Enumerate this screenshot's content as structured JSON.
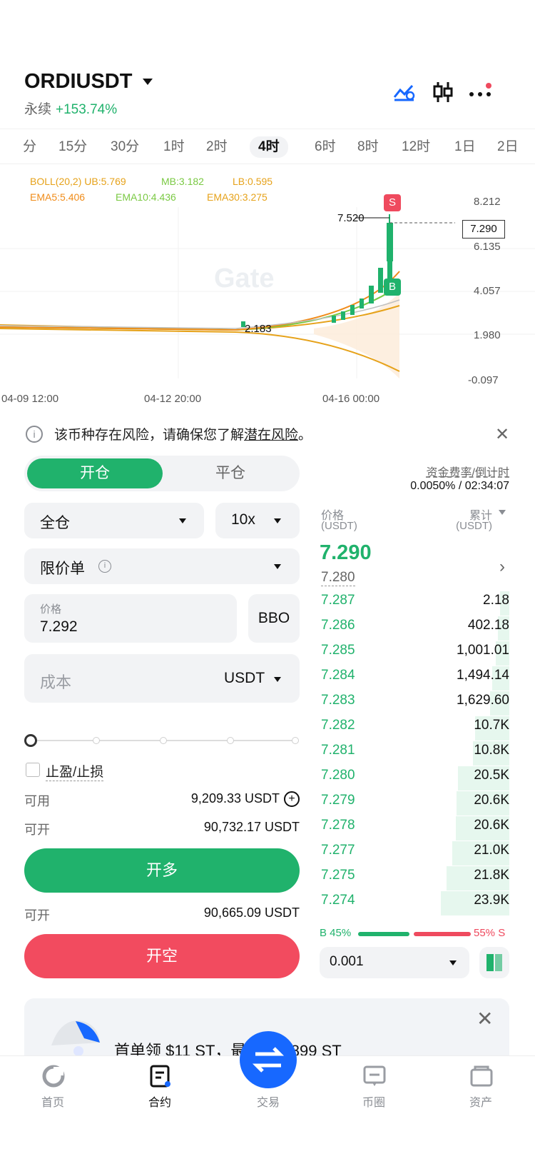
{
  "header": {
    "symbol": "ORDIUSDT",
    "contract_type": "永续",
    "change": "+153.74%",
    "icons": [
      "indicator-icon",
      "candlestick-icon",
      "more-icon"
    ]
  },
  "timeframes": [
    "分",
    "15分",
    "30分",
    "1时",
    "2时",
    "4时",
    "6时",
    "8时",
    "12时",
    "1日",
    "2日"
  ],
  "active_timeframe": "4时",
  "indicators": {
    "boll": "BOLL(20,2)",
    "ub": "UB:5.769",
    "mb": "MB:3.182",
    "lb": "LB:0.595",
    "ema5": "EMA5:5.406",
    "ema10": "EMA10:4.436",
    "ema30": "EMA30:3.275"
  },
  "chart_data": {
    "type": "candlestick",
    "y_ticks": [
      "8.212",
      "6.135",
      "4.057",
      "1.980",
      "-0.097"
    ],
    "x_ticks": [
      "04-09 12:00",
      "04-12 20:00",
      "04-16 00:00"
    ],
    "high_label": "7.520",
    "low_label": "2.183",
    "last_price_label": "7.290",
    "watermark": "Gate",
    "markers": [
      {
        "label": "S",
        "color": "#ef4a5e"
      },
      {
        "label": "B",
        "color": "#20b26c"
      }
    ]
  },
  "risk_notice": {
    "text_before": "该币种存在风险，请确保您了解",
    "link": "潜在风险",
    "text_after": "。"
  },
  "order_form": {
    "tab_open": "开仓",
    "tab_close": "平仓",
    "margin_mode": "全仓",
    "leverage": "10x",
    "order_type": "限价单",
    "price_label": "价格",
    "price_value": "7.292",
    "bbo": "BBO",
    "cost_placeholder": "成本",
    "cost_unit": "USDT",
    "tp_sl": "止盈/止损",
    "available_label": "可用",
    "available_value": "9,209.33 USDT",
    "can_open_label": "可开",
    "can_open_long": "90,732.17 USDT",
    "long_button": "开多",
    "can_open_short": "90,665.09 USDT",
    "short_button": "开空"
  },
  "funding": {
    "label": "资金费率/倒计时",
    "value": "0.0050% / 02:34:07"
  },
  "orderbook": {
    "price_header": "价格",
    "price_unit": "(USDT)",
    "total_header": "累计",
    "total_unit": "(USDT)",
    "last_price": "7.290",
    "mark_price": "7.280",
    "bids": [
      {
        "price": "7.287",
        "qty": "2.18",
        "depth": 0.08
      },
      {
        "price": "7.286",
        "qty": "402.18",
        "depth": 0.1
      },
      {
        "price": "7.285",
        "qty": "1,001.01",
        "depth": 0.12
      },
      {
        "price": "7.284",
        "qty": "1,494.14",
        "depth": 0.15
      },
      {
        "price": "7.283",
        "qty": "1,629.60",
        "depth": 0.17
      },
      {
        "price": "7.282",
        "qty": "10.7K",
        "depth": 0.3
      },
      {
        "price": "7.281",
        "qty": "10.8K",
        "depth": 0.32
      },
      {
        "price": "7.280",
        "qty": "20.5K",
        "depth": 0.45
      },
      {
        "price": "7.279",
        "qty": "20.6K",
        "depth": 0.46
      },
      {
        "price": "7.278",
        "qty": "20.6K",
        "depth": 0.47
      },
      {
        "price": "7.277",
        "qty": "21.0K",
        "depth": 0.5
      },
      {
        "price": "7.275",
        "qty": "21.8K",
        "depth": 0.55
      },
      {
        "price": "7.274",
        "qty": "23.9K",
        "depth": 0.6
      }
    ],
    "buy_ratio": "B 45%",
    "sell_ratio": "55% S",
    "precision": "0.001"
  },
  "banner": {
    "text": "首单领 $11 ST，最高领 $899 ST"
  },
  "nav": {
    "home": "首页",
    "contract": "合约",
    "trade": "交易",
    "community": "币圈",
    "assets": "资产"
  },
  "colors": {
    "green": "#20b26c",
    "red": "#ef4a5e",
    "blue": "#1768ff"
  }
}
